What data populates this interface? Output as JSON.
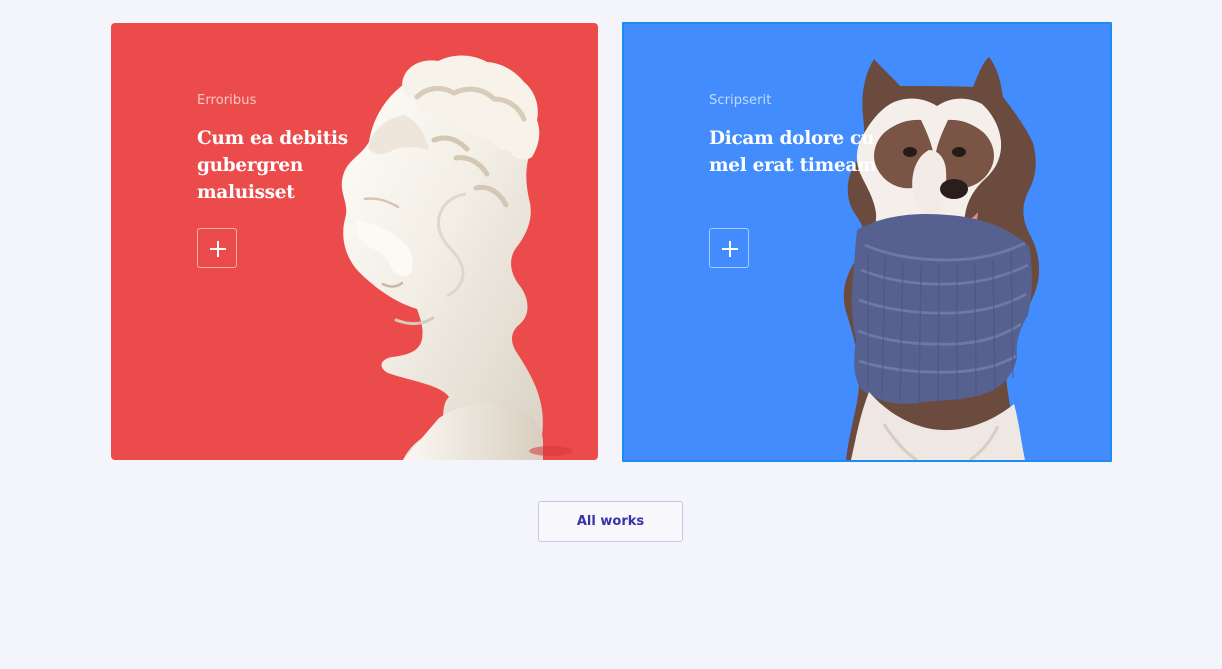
{
  "cards": [
    {
      "eyebrow": "Erroribus",
      "title": "Cum ea debitis gubergren maluisset",
      "image_subject": "classical-bust",
      "color": "#ec4b4b",
      "icon": "plus-icon"
    },
    {
      "eyebrow": "Scripserit",
      "title": "Dicam dolore cu mel erat timeam",
      "image_subject": "husky-in-scarf",
      "color": "#428cfd",
      "icon": "plus-icon"
    }
  ],
  "cta": {
    "label": "All works"
  },
  "colors": {
    "background": "#f4f5fa",
    "selection_outline": "#1d8cf2",
    "cta_text": "#3833a8",
    "cta_border": "#c7c7ee"
  }
}
